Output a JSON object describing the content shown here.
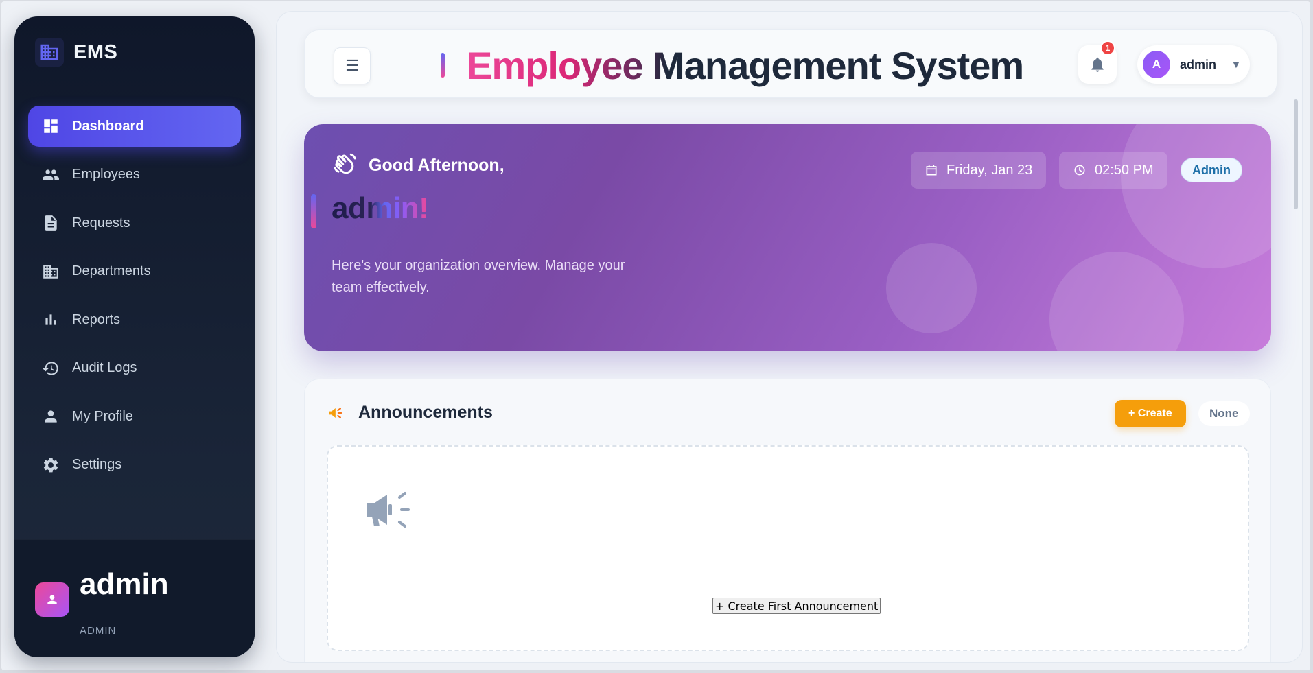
{
  "brand": {
    "name": "EMS"
  },
  "sidebar": {
    "items": [
      {
        "label": "Dashboard",
        "icon": "dashboard-icon",
        "active": true
      },
      {
        "label": "Employees",
        "icon": "people-icon"
      },
      {
        "label": "Requests",
        "icon": "document-icon"
      },
      {
        "label": "Departments",
        "icon": "building-icon"
      },
      {
        "label": "Reports",
        "icon": "bar-chart-icon"
      },
      {
        "label": "Audit Logs",
        "icon": "history-icon"
      },
      {
        "label": "My Profile",
        "icon": "person-icon"
      },
      {
        "label": "Settings",
        "icon": "gear-icon"
      }
    ],
    "user": {
      "name": "admin",
      "role": "ADMIN"
    }
  },
  "header": {
    "title": "Employee Management System",
    "notification_count": "1",
    "user": {
      "initial": "A",
      "name": "admin",
      "caret": "▼"
    },
    "menu_glyph": "☰"
  },
  "hero": {
    "greeting": "Good Afternoon,",
    "name": "admin!",
    "description": "Here's your organization overview. Manage your team effectively.",
    "date": "Friday, Jan 23",
    "time": "02:50 PM",
    "role": "Admin"
  },
  "announcements": {
    "title": "Announcements",
    "create_label": "+ Create",
    "filter_label": "None",
    "empty_button": "+ Create First Announcement"
  },
  "colors": {
    "accent": "#4f46e5",
    "warning": "#f59e0b",
    "danger": "#ef4444",
    "sidebar_bg": "#0f172a"
  }
}
